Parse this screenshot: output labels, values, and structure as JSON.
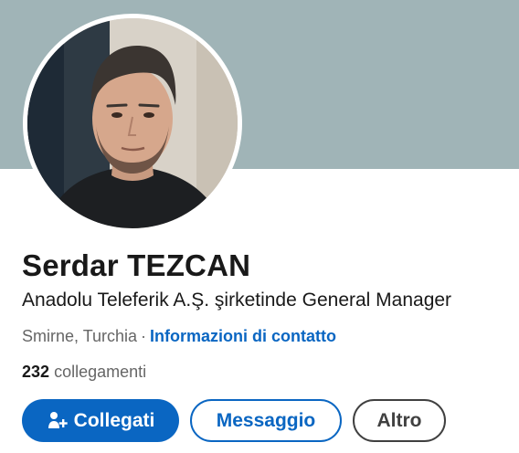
{
  "profile": {
    "name": "Serdar TEZCAN",
    "headline": "Anadolu Teleferik A.Ş. şirketinde General Manager",
    "location": "Smirne, Turchia",
    "separator": "·",
    "contact_link": "Informazioni di contatto",
    "connections_count": "232",
    "connections_label": "collegamenti"
  },
  "actions": {
    "connect_label": "Collegati",
    "connect_icon": "add-person-icon",
    "message_label": "Messaggio",
    "more_label": "Altro"
  },
  "colors": {
    "cover": "#a0b4b7",
    "accent": "#0a66c2",
    "muted_text": "#666666",
    "dark_outline": "#404040"
  }
}
